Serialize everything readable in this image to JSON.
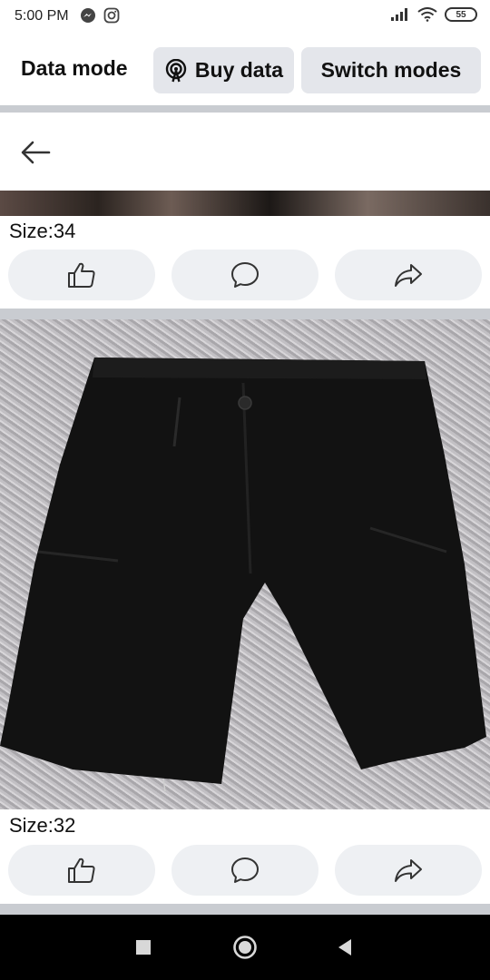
{
  "status_bar": {
    "time": "5:00 PM",
    "battery": "55",
    "icons": [
      "messenger-icon",
      "instagram-icon",
      "signal-icon",
      "wifi-icon",
      "battery-icon"
    ]
  },
  "top_bar": {
    "title": "Data mode",
    "buy_data_label": "Buy data",
    "switch_modes_label": "Switch modes"
  },
  "posts": [
    {
      "size_label": "Size:34"
    },
    {
      "size_label": "Size:32"
    }
  ],
  "actions": [
    "like-icon",
    "comment-icon",
    "share-icon"
  ],
  "colors": {
    "pill_bg": "#e4e6eb",
    "action_bg": "#eef0f3",
    "divider": "#c9ccd1",
    "nav_bar": "#000000"
  },
  "system_nav": [
    "recent-apps-icon",
    "home-icon",
    "back-icon"
  ]
}
